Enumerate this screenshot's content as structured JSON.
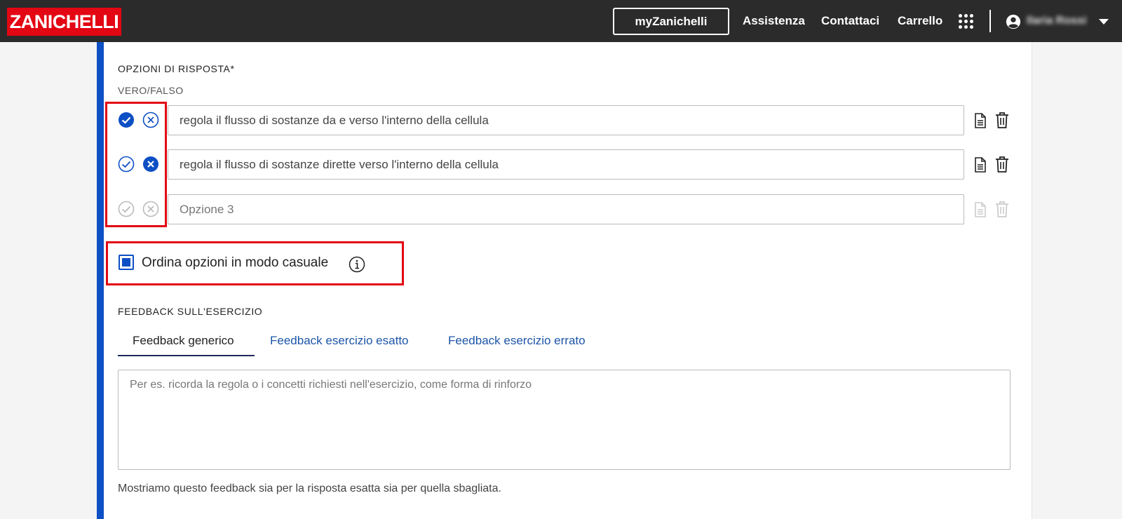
{
  "header": {
    "logo": "ZANICHELLI",
    "my_button": "myZanichelli",
    "nav": [
      "Assistenza",
      "Contattaci",
      "Carrello"
    ],
    "user_name": "Ilaria Rossi"
  },
  "answer_options": {
    "title": "OPZIONI DI RISPOSTA*",
    "subtitle": "VERO/FALSO",
    "options": [
      {
        "value": "regola il flusso di sostanze da e verso l'interno della cellula",
        "placeholder": "",
        "selected": "true"
      },
      {
        "value": "regola il flusso di sostanze dirette verso l'interno della cellula",
        "placeholder": "",
        "selected": "false"
      },
      {
        "value": "",
        "placeholder": "Opzione 3",
        "selected": "none"
      }
    ]
  },
  "shuffle": {
    "label": "Ordina opzioni in modo casuale",
    "checked": true
  },
  "feedback": {
    "title": "FEEDBACK SULL'ESERCIZIO",
    "tabs": [
      "Feedback generico",
      "Feedback esercizio esatto",
      "Feedback esercizio errato"
    ],
    "active_tab": 0,
    "placeholder": "Per es. ricorda la regola o i concetti richiesti nell'esercizio, come forma di rinforzo",
    "helper": "Mostriamo questo feedback sia per la risposta esatta sia per quella sbagliata."
  },
  "colors": {
    "brand_red": "#e30613",
    "accent_blue": "#0d4fc4",
    "topbar": "#2b2b2b"
  }
}
